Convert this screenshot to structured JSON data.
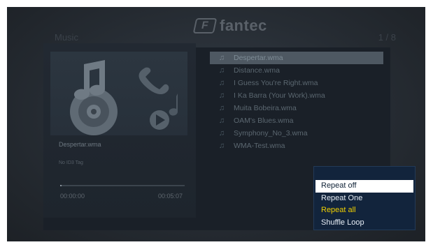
{
  "brand": {
    "name": "fantec",
    "logo_mark": "F"
  },
  "header": {
    "title": "Music",
    "pager": "1 / 8"
  },
  "now_playing": {
    "track_title": "Despertar.wma",
    "id3_info": "No ID3 Tag",
    "time_elapsed": "00:00:00",
    "time_total": "00:05:07",
    "progress_fraction": 0.01
  },
  "playlist": [
    {
      "label": "Despertar.wma",
      "selected": true,
      "icon": "music-note-icon"
    },
    {
      "label": "Distance.wma",
      "selected": false,
      "icon": "music-note-icon"
    },
    {
      "label": "I Guess You're Right.wma",
      "selected": false,
      "icon": "music-note-icon"
    },
    {
      "label": "I Ka Barra (Your Work).wma",
      "selected": false,
      "icon": "music-note-icon"
    },
    {
      "label": "Muita Bobeira.wma",
      "selected": false,
      "icon": "music-note-icon"
    },
    {
      "label": "OAM's Blues.wma",
      "selected": false,
      "icon": "music-note-icon"
    },
    {
      "label": "Symphony_No_3.wma",
      "selected": false,
      "icon": "music-note-icon"
    },
    {
      "label": "WMA-Test.wma",
      "selected": false,
      "icon": "music-note-icon"
    }
  ],
  "repeat_menu": {
    "items": [
      {
        "label": "Repeat off",
        "state": "focused"
      },
      {
        "label": "Repeat One",
        "state": "normal"
      },
      {
        "label": "Repeat all",
        "state": "highlight"
      },
      {
        "label": "Shuffle Loop",
        "state": "normal"
      }
    ]
  },
  "colors": {
    "menu_bg": "#12243c",
    "menu_highlight": "#f0d000",
    "selection_bg": "#4e5862"
  }
}
